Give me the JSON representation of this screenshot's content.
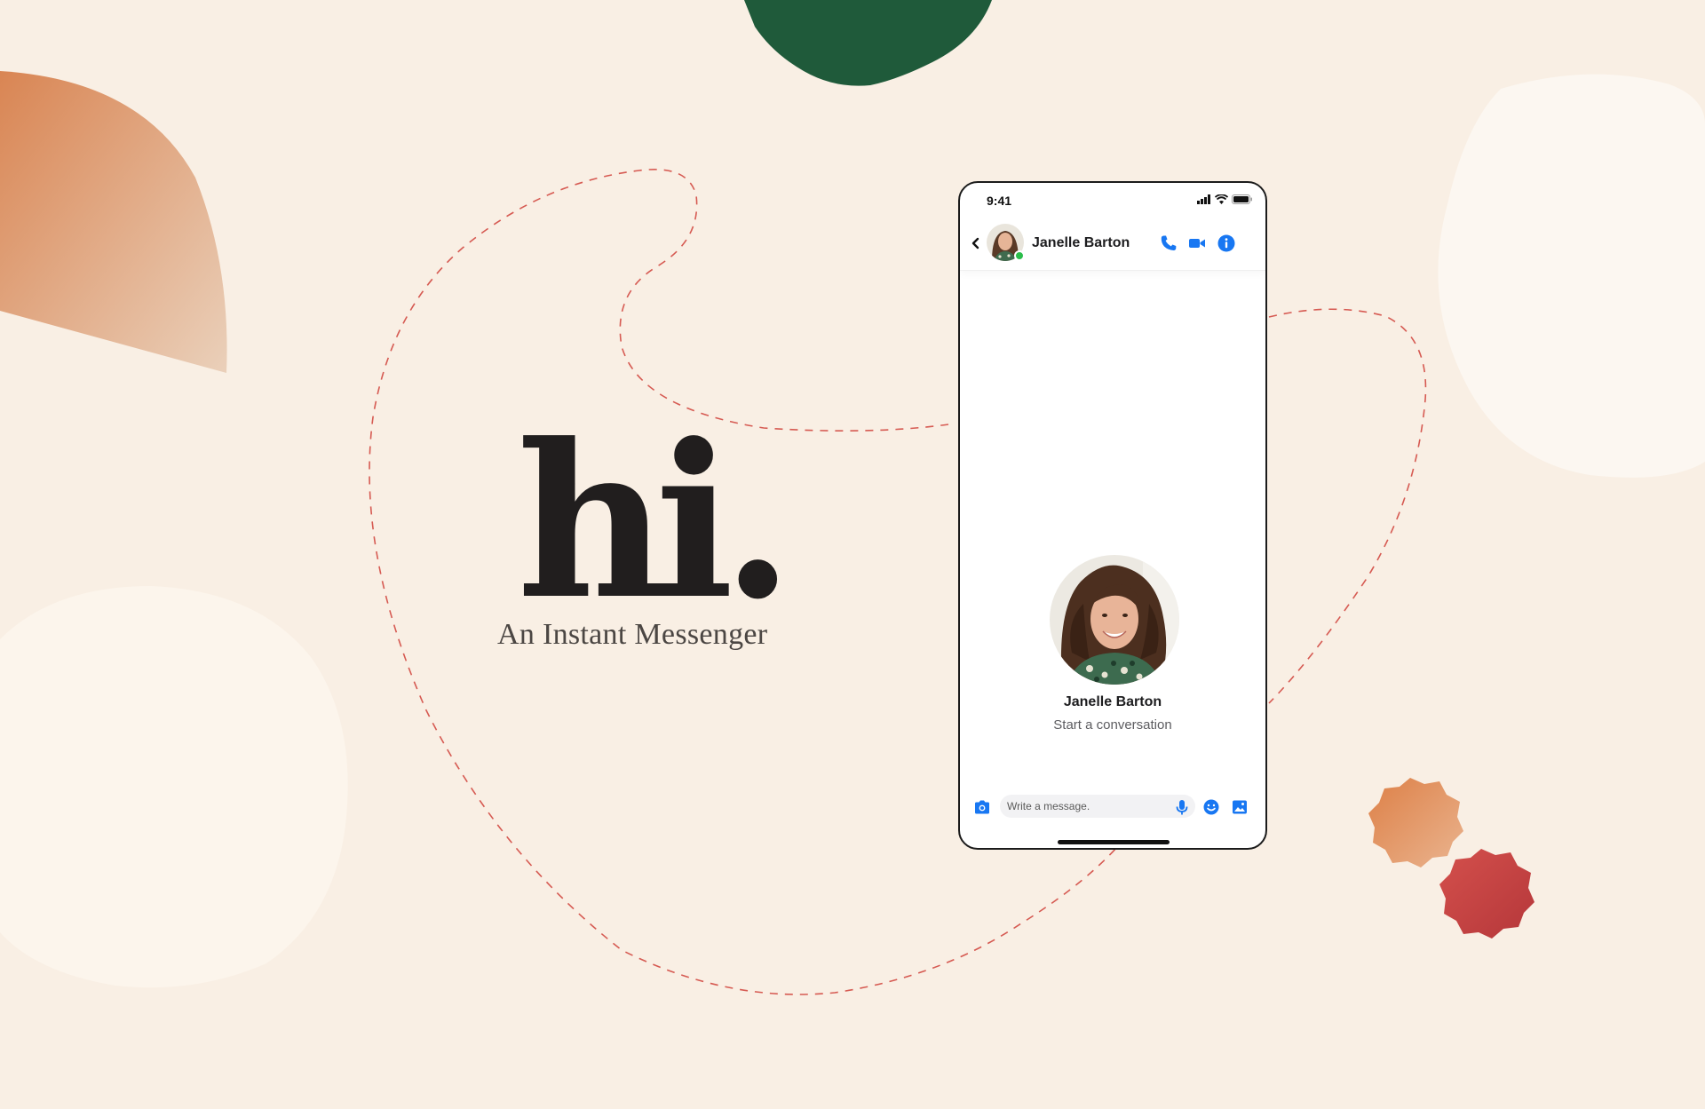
{
  "brand": {
    "hi": "hi.",
    "tagline": "An Instant Messenger"
  },
  "phone": {
    "status": {
      "time": "9:41"
    },
    "header": {
      "contact_name": "Janelle Barton"
    },
    "empty_state": {
      "contact_name": "Janelle Barton",
      "subtitle": "Start a conversation"
    },
    "composer": {
      "placeholder": "Write a message."
    }
  },
  "colors": {
    "background": "#f9efe4",
    "accent_blue": "#1877f2",
    "online_green": "#2bbd4b",
    "dashed_line": "#d65a52",
    "blob_green": "#1f5a3a",
    "blob_orange": "#df9a6b",
    "blob_red": "#c5423f"
  },
  "icons": {
    "header": [
      "back-chevron-icon",
      "phone-call-icon",
      "video-call-icon",
      "info-icon"
    ],
    "composer": [
      "camera-icon",
      "microphone-icon",
      "emoji-icon",
      "image-icon"
    ]
  }
}
